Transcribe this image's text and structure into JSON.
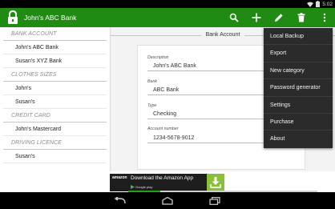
{
  "status_bar": {
    "time": "5:02",
    "icons": [
      "wifi-icon",
      "battery-icon"
    ]
  },
  "action_bar": {
    "app_icon": "lock-icon",
    "title": "John's ABC Bank",
    "actions": [
      "search-icon",
      "add-icon",
      "edit-icon",
      "delete-icon",
      "overflow-menu-icon"
    ]
  },
  "sidebar": {
    "groups": [
      {
        "category": "BANK ACCOUNT",
        "items": [
          "John's ABC Bank",
          "Susan's XYZ Bank"
        ]
      },
      {
        "category": "CLOTHES SIZES",
        "items": [
          "John's",
          "Susan's"
        ]
      },
      {
        "category": "CREDIT CARD",
        "items": [
          "John's Mastercard"
        ]
      },
      {
        "category": "DRIVING LICENCE",
        "items": [
          "Susan's"
        ]
      }
    ]
  },
  "detail": {
    "header": "Bank Account",
    "fields": [
      {
        "label": "Description",
        "value": "John's ABC Bank"
      },
      {
        "label": "Bank",
        "value": "ABC Bank"
      },
      {
        "label": "Type",
        "value": "Checking"
      },
      {
        "label": "Account number",
        "value": "1234-5678-9012"
      }
    ],
    "progress": 0.17
  },
  "ad": {
    "logo": "amazon",
    "text": "Download the Amazon App",
    "badge": "Google play",
    "icon": "download-icon"
  },
  "menu": {
    "items": [
      "Local Backup",
      "Export",
      "New category",
      "Password generator",
      "Settings",
      "Purchase",
      "About"
    ]
  },
  "nav_bar": {
    "buttons": [
      "back-icon",
      "home-icon",
      "recents-icon"
    ]
  },
  "colors": {
    "action_bar": "#208b12",
    "menu_bg": "#2b2b2b",
    "progress": "#1fa31f",
    "ad_download": "#8bbf3a"
  }
}
